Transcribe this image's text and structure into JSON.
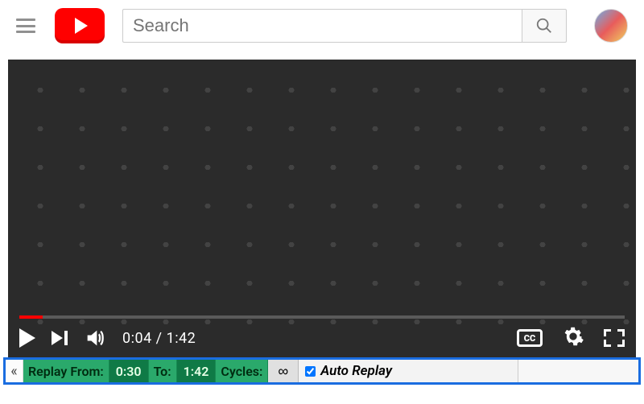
{
  "header": {
    "search_placeholder": "Search"
  },
  "player": {
    "current_time": "0:04",
    "time_sep": " / ",
    "duration": "1:42",
    "cc_label": "CC",
    "progress_percent": 3.9
  },
  "replay": {
    "collapse_glyph": "«",
    "from_label": "Replay From:",
    "from_value": "0:30",
    "to_label": "To:",
    "to_value": "1:42",
    "cycles_label": "Cycles:",
    "cycles_value": "∞",
    "auto_label": "Auto Replay",
    "auto_checked": true
  }
}
